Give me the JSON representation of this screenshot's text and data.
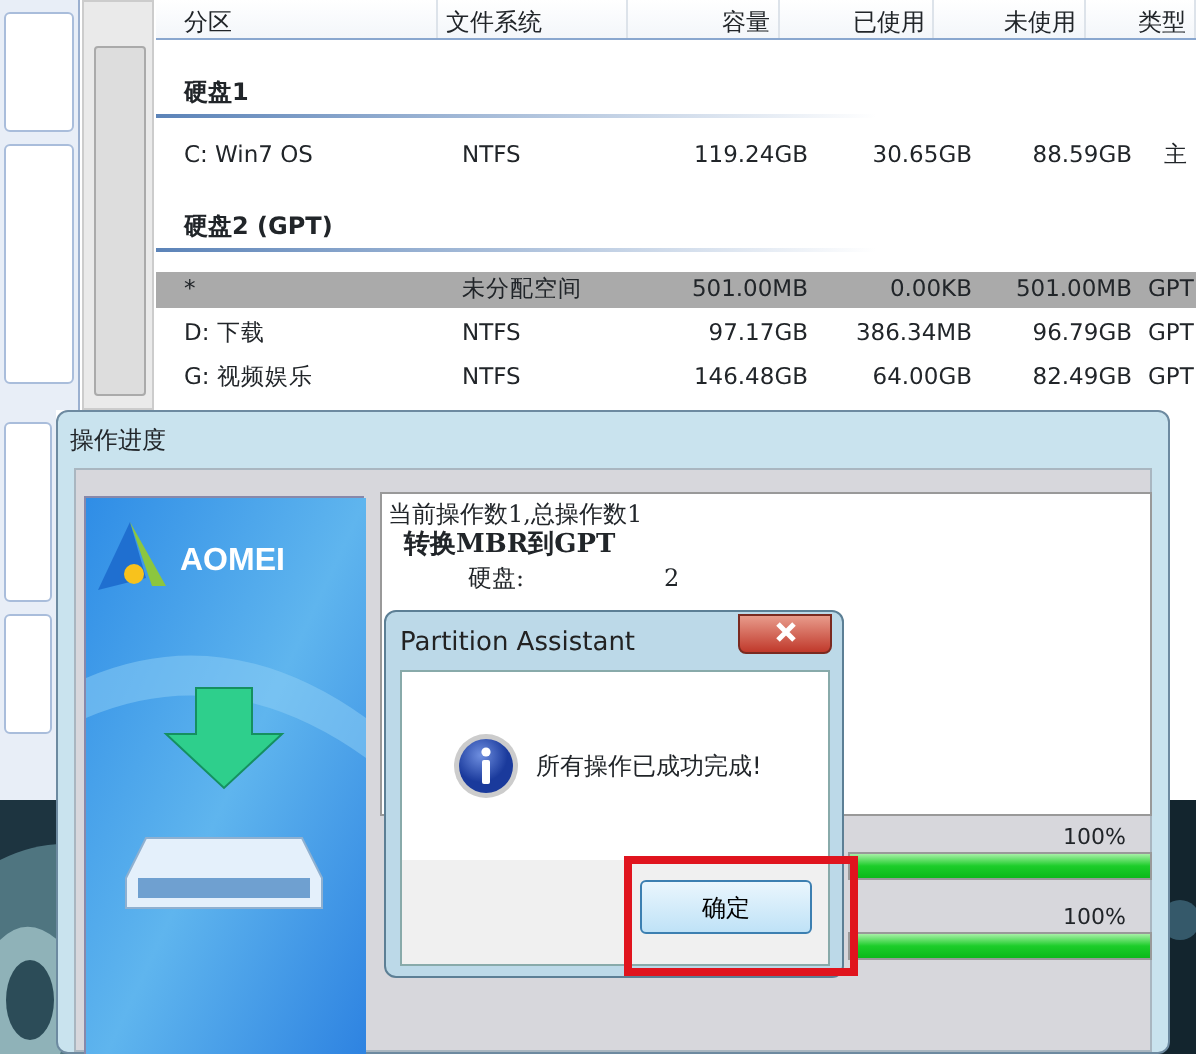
{
  "partition_table": {
    "columns": [
      "分区",
      "文件系统",
      "容量",
      "已使用",
      "未使用",
      "类型"
    ],
    "groups": [
      {
        "title": "硬盘1",
        "rows": [
          {
            "selected": false,
            "cells": [
              "C: Win7 OS",
              "NTFS",
              "119.24GB",
              "30.65GB",
              "88.59GB",
              "主"
            ]
          }
        ]
      },
      {
        "title": "硬盘2 (GPT)",
        "rows": [
          {
            "selected": true,
            "cells": [
              "*",
              "未分配空间",
              "501.00MB",
              "0.00KB",
              "501.00MB",
              "GPT"
            ]
          },
          {
            "selected": false,
            "cells": [
              "D: 下载",
              "NTFS",
              "97.17GB",
              "386.34MB",
              "96.79GB",
              "GPT"
            ]
          },
          {
            "selected": false,
            "cells": [
              "G: 视频娱乐",
              "NTFS",
              "146.48GB",
              "64.00GB",
              "82.49GB",
              "GPT"
            ]
          }
        ]
      }
    ]
  },
  "progress_window": {
    "title": "操作进度",
    "logo": "AOMEI",
    "log": {
      "summary": "当前操作数1,总操作数1",
      "operation": "转换MBR到GPT",
      "details": [
        {
          "label": "硬盘:",
          "value": "2"
        }
      ]
    },
    "progress_bars": [
      {
        "reading": "100%",
        "level": 1
      },
      {
        "reading": "100%",
        "level": 1
      }
    ]
  },
  "dialog": {
    "title": "Partition Assistant",
    "message": "所有操作已成功完成!",
    "button": {
      "label": "确定",
      "highlighted": true
    }
  }
}
